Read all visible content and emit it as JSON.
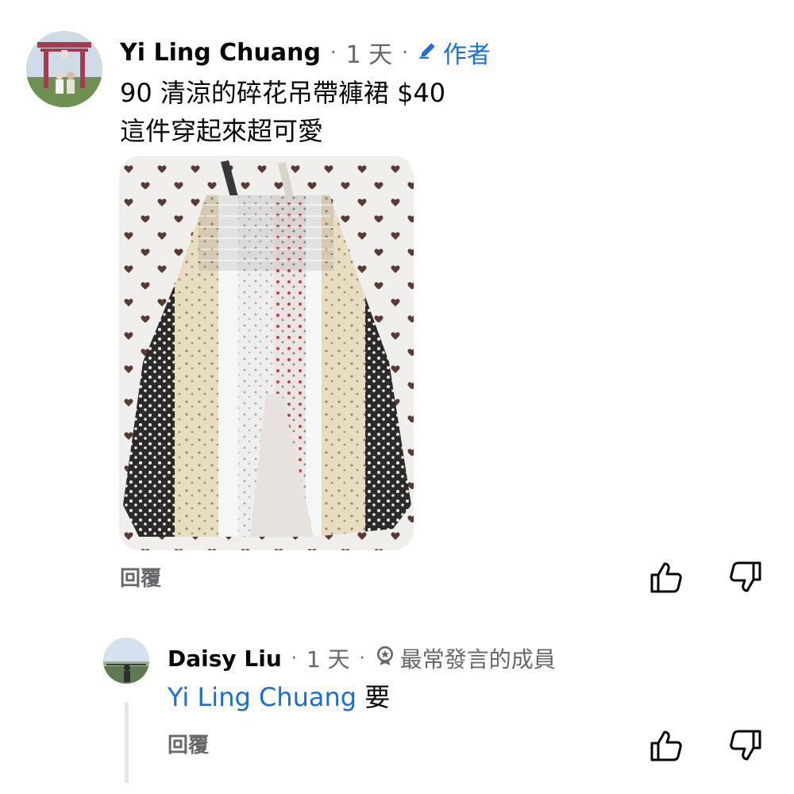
{
  "colors": {
    "link_blue": "#1a6ed8",
    "meta_gray": "#65676b",
    "text": "#050505",
    "thread_line": "#e4e6eb"
  },
  "comment": {
    "author": "Yi Ling Chuang",
    "time": "1 天",
    "separator": "·",
    "badge": "作者",
    "badge_icon": "pencil-icon",
    "lines": [
      "90 清涼的碎花吊帶褲裙 $40",
      "這件穿起來超可愛"
    ],
    "reply_label": "回覆",
    "like_icon": "thumbs-up-icon",
    "dislike_icon": "thumbs-down-icon"
  },
  "reply": {
    "author": "Daisy Liu",
    "time": "1 天",
    "separator": "·",
    "badge": "最常發言的成員",
    "badge_icon": "top-contributor-badge-icon",
    "mention": "Yi Ling Chuang",
    "text": "要",
    "reply_label": "回覆",
    "like_icon": "thumbs-up-icon",
    "dislike_icon": "thumbs-down-icon"
  }
}
